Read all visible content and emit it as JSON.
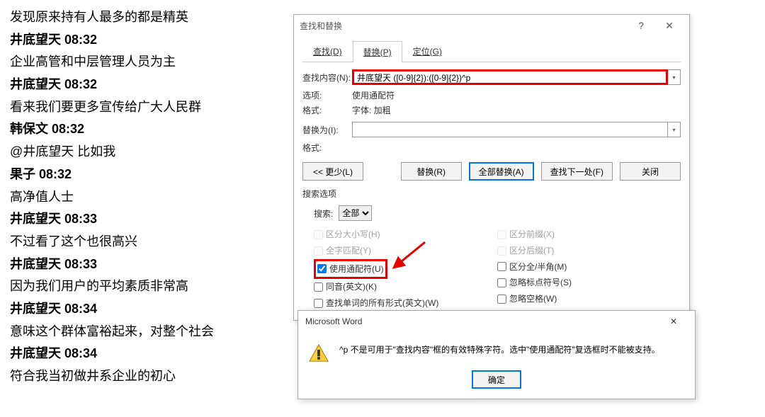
{
  "document": {
    "lines": [
      {
        "text": "发现原来持有人最多的都是精英",
        "bold": false
      },
      {
        "text": "井底望天  08:32",
        "bold": true
      },
      {
        "text": "企业高管和中层管理人员为主",
        "bold": false
      },
      {
        "text": "井底望天  08:32",
        "bold": true
      },
      {
        "text": "看来我们要更多宣传给广大人民群",
        "bold": false
      },
      {
        "text": "韩保文  08:32",
        "bold": true
      },
      {
        "text": "@井底望天 比如我",
        "bold": false
      },
      {
        "text": "果子  08:32",
        "bold": true
      },
      {
        "text": "高净值人士",
        "bold": false
      },
      {
        "text": "井底望天  08:33",
        "bold": true
      },
      {
        "text": "不过看了这个也很高兴",
        "bold": false
      },
      {
        "text": "井底望天  08:33",
        "bold": true
      },
      {
        "text": "因为我们用户的平均素质非常高",
        "bold": false
      },
      {
        "text": "井底望天  08:34",
        "bold": true
      },
      {
        "text": "意味这个群体富裕起来，对整个社会",
        "bold": false
      },
      {
        "text": "井底望天  08:34",
        "bold": true
      },
      {
        "text": "符合我当初做井系企业的初心",
        "bold": false
      }
    ]
  },
  "dialog": {
    "title": "查找和替换",
    "tabs": {
      "find": "查找(D)",
      "replace": "替换(P)",
      "goto": "定位(G)"
    },
    "find_label": "查找内容(N):",
    "find_value": "井底望天 ([0-9]{2}):([0-9]{2})^p",
    "options_label": "选项:",
    "options_value": "使用通配符",
    "format_label": "格式:",
    "format_value": "字体: 加粗",
    "replace_label": "替换为(I):",
    "replace_value": "",
    "format2_label": "格式:",
    "buttons": {
      "less": "<< 更少(L)",
      "replace": "替换(R)",
      "replace_all": "全部替换(A)",
      "find_next": "查找下一处(F)",
      "close": "关闭"
    },
    "opts_title": "搜索选项",
    "search_dir_label": "搜索:",
    "search_dir_value": "全部",
    "checks": {
      "match_case": "区分大小写(H)",
      "whole_word": "全字匹配(Y)",
      "wildcards": "使用通配符(U)",
      "sounds_like": "同音(英文)(K)",
      "all_forms": "查找单词的所有形式(英文)(W)",
      "prefix": "区分前缀(X)",
      "suffix": "区分后缀(T)",
      "fullwidth": "区分全/半角(M)",
      "ignore_punct": "忽略标点符号(S)",
      "ignore_space": "忽略空格(W)"
    }
  },
  "msgbox": {
    "title": "Microsoft Word",
    "text": "^p 不是可用于\"查找内容\"框的有效特殊字符。选中\"使用通配符\"复选框时不能被支持。",
    "ok": "确定"
  }
}
